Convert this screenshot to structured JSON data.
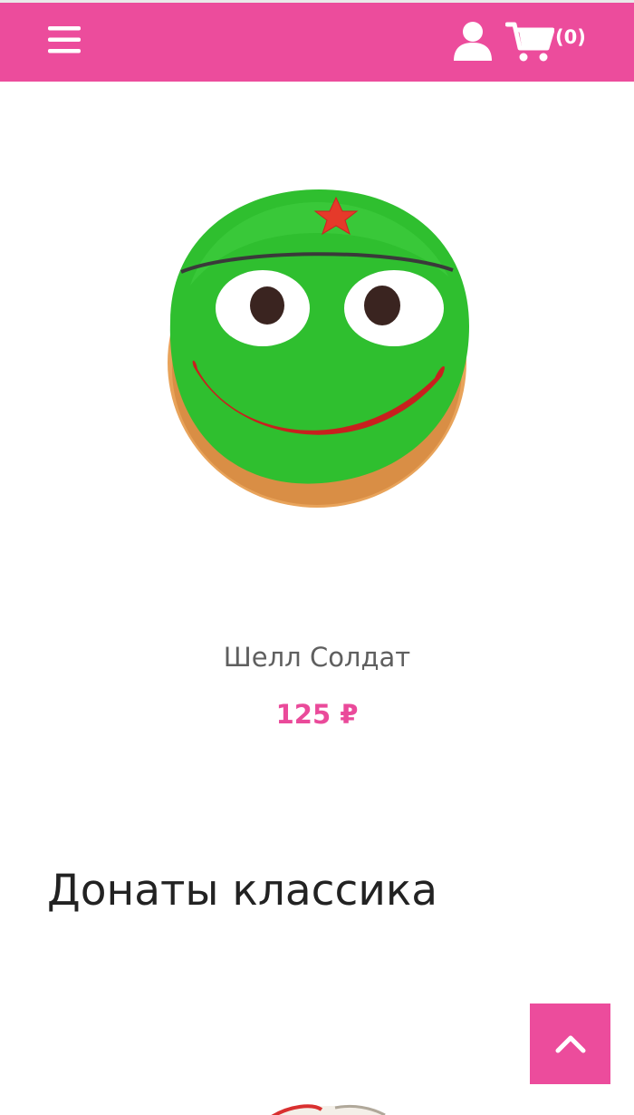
{
  "header": {
    "background_color": "#ec4c9c",
    "menu_icon": "hamburger-menu-icon",
    "account_icon": "user-icon",
    "cart_icon": "cart-icon",
    "cart_count": "(0)"
  },
  "product": {
    "name": "Шелл Солдат",
    "price": "125 ₽",
    "price_color": "#ea4a9a"
  },
  "section": {
    "title": "Донаты классика"
  },
  "scroll_top": {
    "icon": "chevron-up-icon"
  }
}
